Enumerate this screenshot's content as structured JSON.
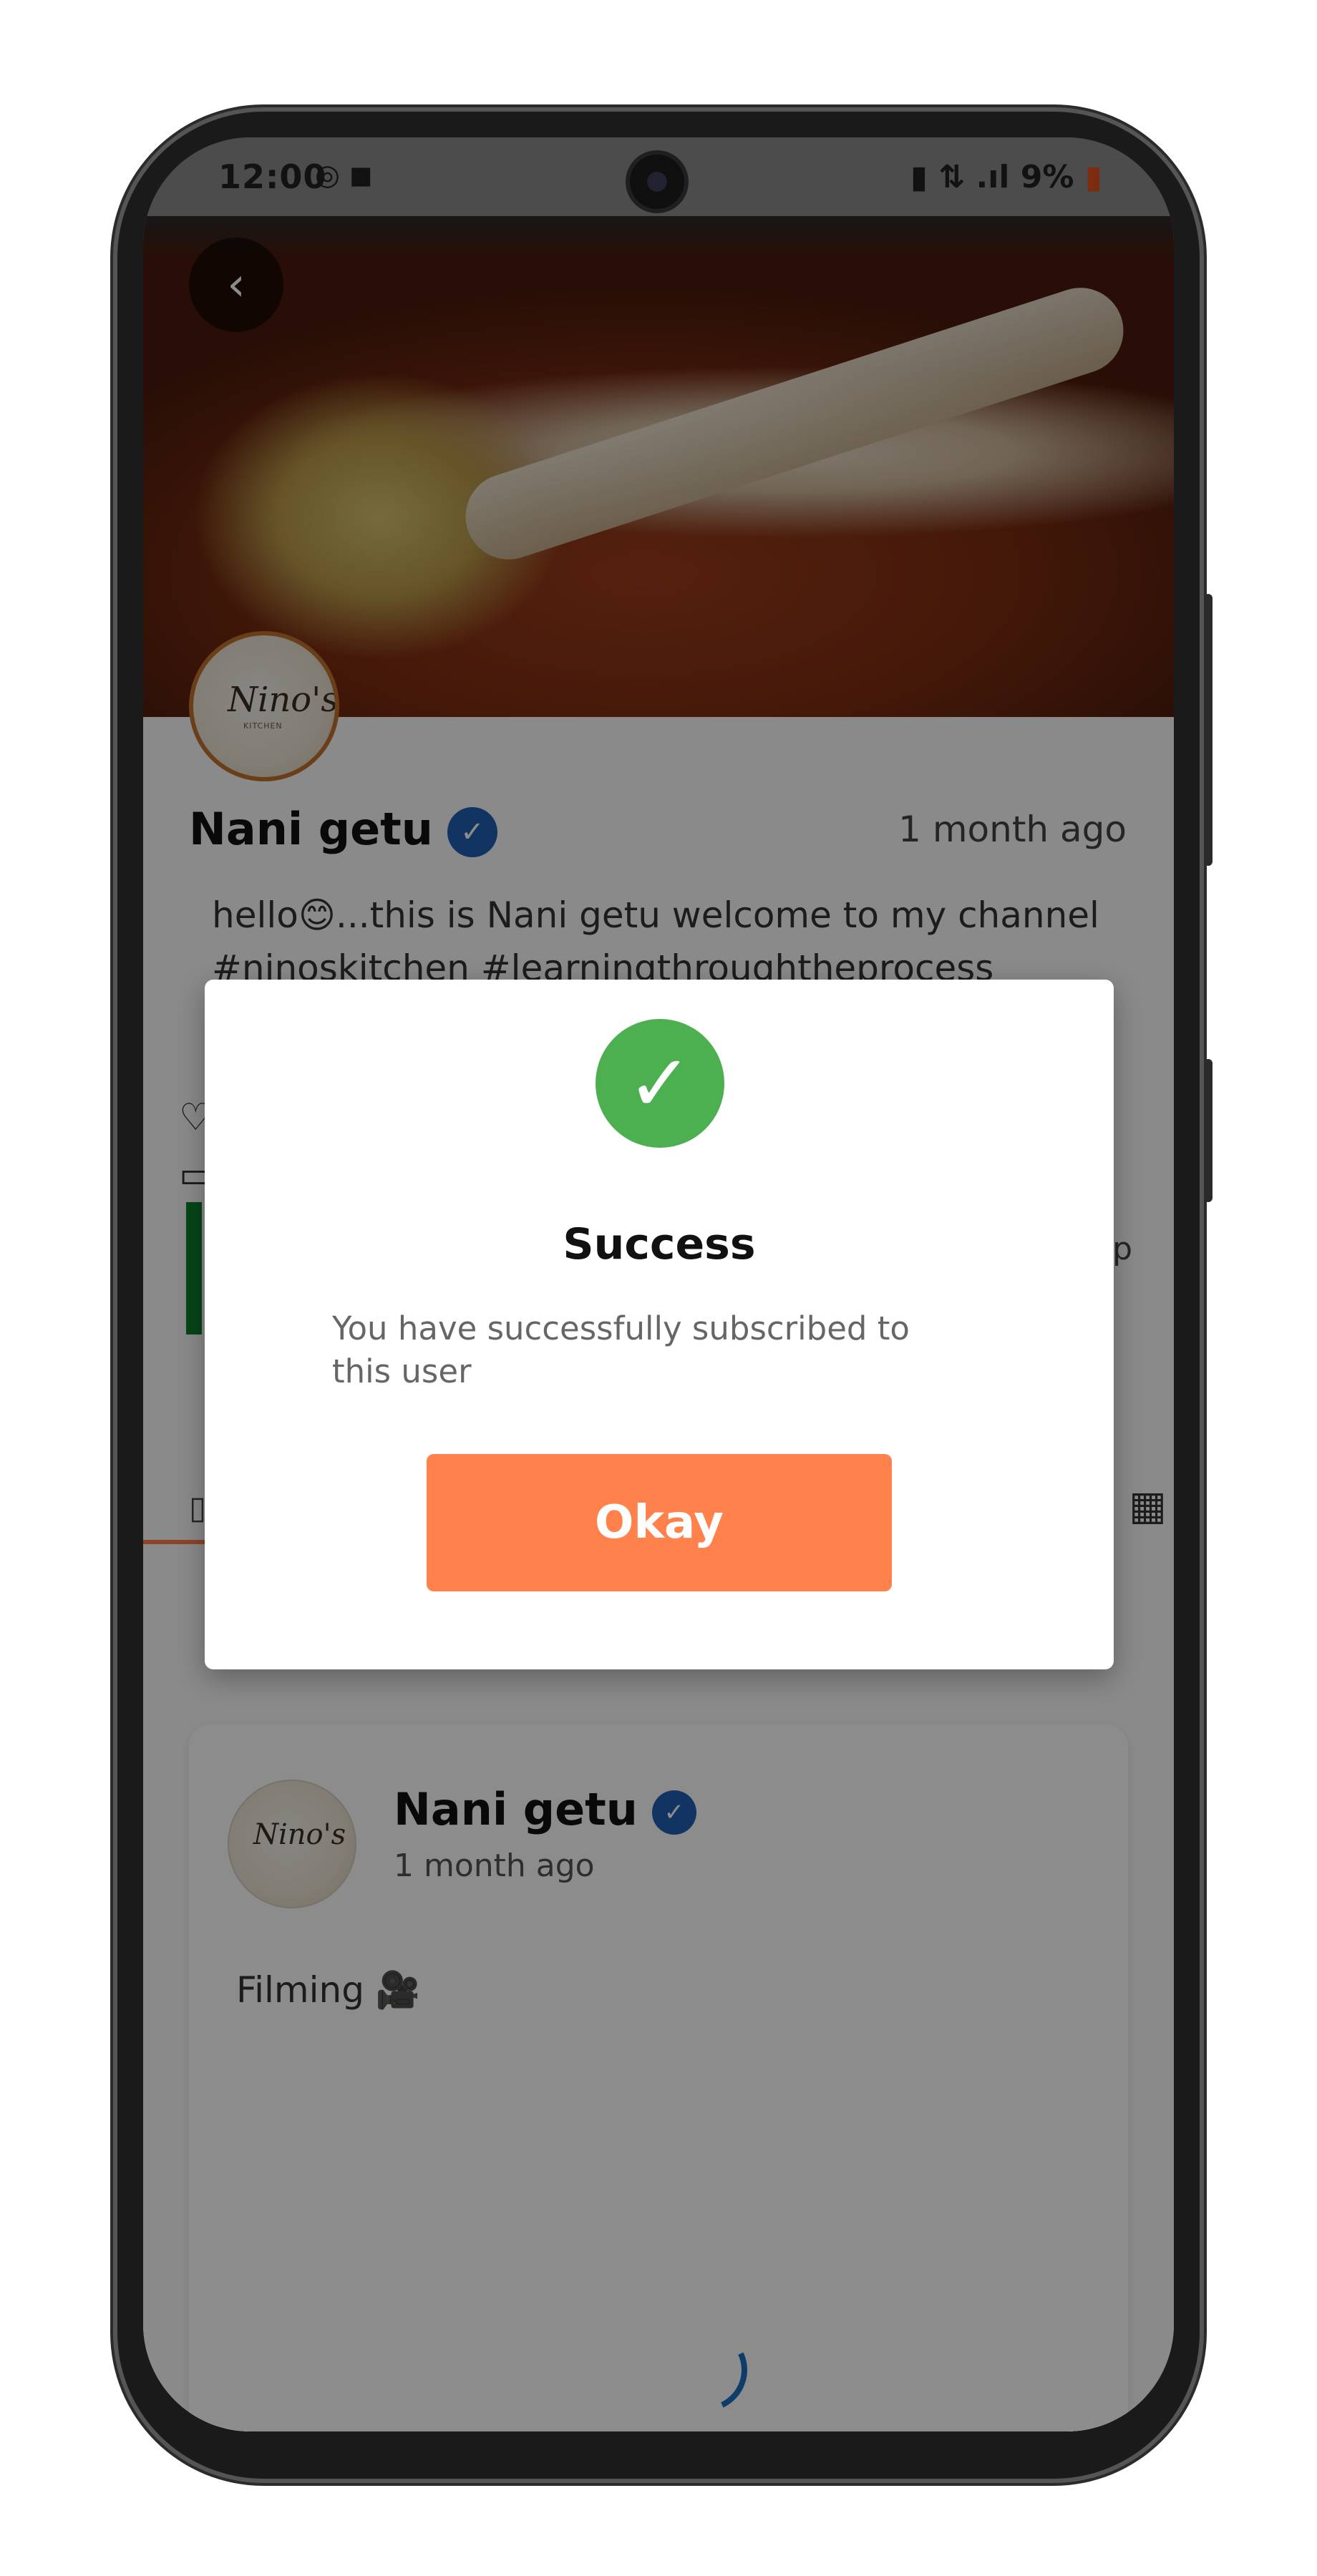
{
  "status_bar": {
    "time": "12:00",
    "battery": "9%"
  },
  "hero": {
    "back_icon": "chevron-left-icon"
  },
  "profile": {
    "name": "Nani getu",
    "time_ago": "1 month ago",
    "bio_line1": "hello😊...this is Nani getu welcome to my channel",
    "bio_line2": "#ninoskitchen #learningthroughtheprocess",
    "avatar_text": "Nino's",
    "avatar_sub": "KITCHEN",
    "side_partial_text": "p"
  },
  "post": {
    "name": "Nani getu",
    "time_ago": "1 month ago",
    "text": "Filming 🎥"
  },
  "dialog": {
    "title": "Success",
    "message": "You have successfully subscribed to this user",
    "okay_label": "Okay"
  },
  "colors": {
    "accent": "#ff824d",
    "success": "#4caf50",
    "verified": "#1f5fb3"
  }
}
